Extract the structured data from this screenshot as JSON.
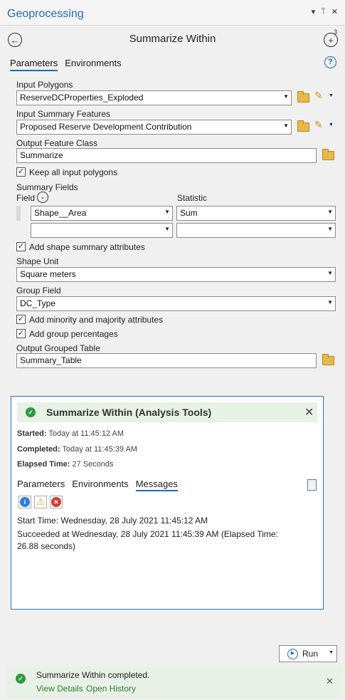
{
  "titlebar": {
    "title": "Geoprocessing",
    "icons": [
      "▾",
      "ᵖ",
      "✕"
    ]
  },
  "tool": {
    "title": "Summarize Within",
    "back_icon": "arrow-left-icon",
    "add_icon": "add-icon",
    "add_badge": "3"
  },
  "tabs": {
    "parameters": "Parameters",
    "environments": "Environments",
    "help": "?"
  },
  "params": {
    "input_polygons_label": "Input Polygons",
    "input_polygons_value": "ReserveDCProperties_Exploded",
    "input_summary_label": "Input Summary Features",
    "input_summary_value": "Proposed Reserve Development Contribution",
    "output_fc_label": "Output Feature Class",
    "output_fc_value": "Summarize",
    "keep_all_label": "Keep all input polygons",
    "summary_fields_label": "Summary Fields",
    "field_col": "Field",
    "statistic_col": "Statistic",
    "field_row1": "Shape__Area",
    "stat_row1": "Sum",
    "add_shape_label": "Add shape summary  attributes",
    "shape_unit_label": "Shape Unit",
    "shape_unit_value": "Square meters",
    "group_field_label": "Group Field",
    "group_field_value": "DC_Type",
    "minority_label": "Add minority and majority attributes",
    "group_pct_label": "Add group percentages",
    "output_grouped_label": "Output Grouped Table",
    "output_grouped_value": "Summary_Table"
  },
  "result": {
    "title": "Summarize Within (Analysis Tools)",
    "started_label": "Started:",
    "started_value": " Today at 11:45:12 AM",
    "completed_label": "Completed:",
    "completed_value": " Today at 11:45:39 AM",
    "elapsed_label": "Elapsed Time:",
    "elapsed_value": " 27 Seconds",
    "tab_parameters": "Parameters",
    "tab_environments": "Environments",
    "tab_messages": "Messages",
    "msg1": "Start Time: Wednesday, 28 July 2021 11:45:12 AM",
    "msg2": "Succeeded at Wednesday, 28 July 2021 11:45:39 AM (Elapsed Time: 26.88 seconds)"
  },
  "run_label": "Run",
  "status": {
    "text": "Summarize Within completed.",
    "view_details": "View Details",
    "open_history": "Open History"
  },
  "colors": {
    "accent": "#1e6bbf",
    "success": "#2c9a3f",
    "success_bg": "#e7f1e6"
  }
}
